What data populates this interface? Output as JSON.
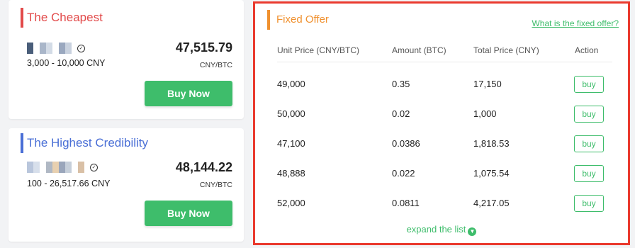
{
  "cheapest": {
    "title": "The Cheapest",
    "range": "3,000 - 10,000 CNY",
    "price": "47,515.79",
    "unit": "CNY/BTC",
    "button": "Buy Now",
    "avatar_colors": [
      "#4a5e7a",
      "#ffffff",
      "#a9b6c9",
      "#d3dbe6",
      "#ffffff",
      "#9aa8bf",
      "#c9d2df"
    ]
  },
  "credible": {
    "title": "The Highest Credibility",
    "range": "100 - 26,517.66 CNY",
    "price": "48,144.22",
    "unit": "CNY/BTC",
    "button": "Buy Now",
    "avatar_colors": [
      "#b9c6dc",
      "#d7dfeb",
      "#ffffff",
      "#b0b8c4",
      "#e8d0b0",
      "#9aa6bb",
      "#c6cfda",
      "#ffffff",
      "#d9c0a6"
    ]
  },
  "fixed": {
    "title": "Fixed Offer",
    "link": "What is the fixed offer?",
    "columns": [
      "Unit Price (CNY/BTC)",
      "Amount (BTC)",
      "Total Price (CNY)",
      "Action"
    ],
    "rows": [
      {
        "unit_price": "49,000",
        "amount": "0.35",
        "total": "17,150",
        "action": "buy"
      },
      {
        "unit_price": "50,000",
        "amount": "0.02",
        "total": "1,000",
        "action": "buy"
      },
      {
        "unit_price": "47,100",
        "amount": "0.0386",
        "total": "1,818.53",
        "action": "buy"
      },
      {
        "unit_price": "48,888",
        "amount": "0.022",
        "total": "1,075.54",
        "action": "buy"
      },
      {
        "unit_price": "52,000",
        "amount": "0.0811",
        "total": "4,217.05",
        "action": "buy"
      }
    ],
    "expand_label": "expand the list",
    "expand_icon": "chevron-down-circle-icon"
  },
  "colors": {
    "red": "#e24a4a",
    "blue": "#4a6fd6",
    "orange": "#f0912f",
    "green": "#3ebd6b",
    "highlight_border": "#ea3a2e"
  }
}
